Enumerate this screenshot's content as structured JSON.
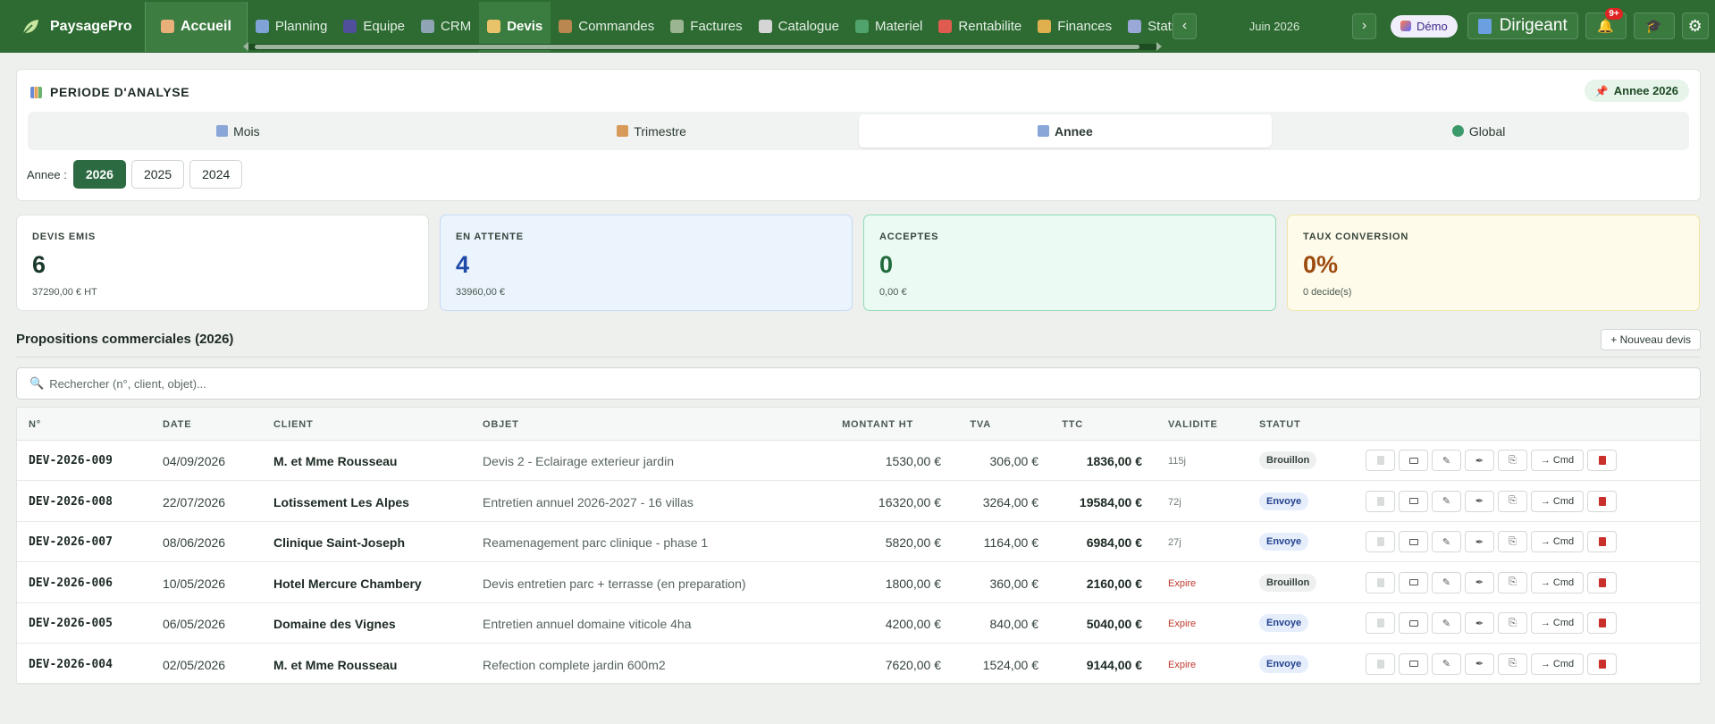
{
  "brand": {
    "name": "PaysagePro",
    "home_label": "Accueil"
  },
  "nav": [
    {
      "label": "Planning",
      "icon": "calendar-icon",
      "color": "#7fa3d6"
    },
    {
      "label": "Equipe",
      "icon": "team-icon",
      "color": "#4f4f9c"
    },
    {
      "label": "CRM",
      "icon": "building-icon",
      "color": "#8fa4b5"
    },
    {
      "label": "Devis",
      "icon": "clipboard-icon",
      "color": "#e9c36a",
      "active": true
    },
    {
      "label": "Commandes",
      "icon": "package-icon",
      "color": "#b9874f"
    },
    {
      "label": "Factures",
      "icon": "ledger-icon",
      "color": "#9ab58f"
    },
    {
      "label": "Catalogue",
      "icon": "tools-icon",
      "color": "#d5d5d5"
    },
    {
      "label": "Materiel",
      "icon": "tractor-icon",
      "color": "#4fa36b"
    },
    {
      "label": "Rentabilite",
      "icon": "target-icon",
      "color": "#e05b4f"
    },
    {
      "label": "Finances",
      "icon": "moneybag-icon",
      "color": "#e0b04f"
    },
    {
      "label": "Stats",
      "icon": "chart-icon",
      "color": "#9aa8d8"
    }
  ],
  "header": {
    "month": "Juin 2026",
    "demo_label": "Démo",
    "role_label": "Dirigeant",
    "notif_count": "9+"
  },
  "period": {
    "title": "PERIODE D'ANALYSE",
    "chip": "Annee 2026",
    "tabs": [
      {
        "label": "Mois",
        "icon": "calendar-icon"
      },
      {
        "label": "Trimestre",
        "icon": "bar-chart-icon"
      },
      {
        "label": "Annee",
        "icon": "calendar-icon",
        "active": true
      },
      {
        "label": "Global",
        "icon": "globe-icon"
      }
    ],
    "year_label": "Annee :",
    "years": [
      "2026",
      "2025",
      "2024"
    ],
    "selected_year": "2026"
  },
  "stats": [
    {
      "label": "DEVIS EMIS",
      "value": "6",
      "sub": "37290,00 € HT"
    },
    {
      "label": "EN ATTENTE",
      "value": "4",
      "sub": "33960,00 €"
    },
    {
      "label": "ACCEPTES",
      "value": "0",
      "sub": "0,00 €"
    },
    {
      "label": "TAUX CONVERSION",
      "value": "0%",
      "sub": "0 decide(s)"
    }
  ],
  "section": {
    "title": "Propositions commerciales (2026)",
    "new_button": "+ Nouveau devis",
    "search_placeholder": "Rechercher (n°, client, objet)..."
  },
  "table": {
    "columns": [
      "N°",
      "DATE",
      "CLIENT",
      "OBJET",
      "MONTANT HT",
      "TVA",
      "TTC",
      "VALIDITE",
      "STATUT"
    ],
    "action_convert": "→ Cmd",
    "rows": [
      {
        "num": "DEV-2026-009",
        "date": "04/09/2026",
        "client": "M. et Mme Rousseau",
        "objet": "Devis 2 - Eclairage exterieur jardin",
        "ht": "1530,00 €",
        "tva": "306,00 €",
        "ttc": "1836,00 €",
        "validite": "115j",
        "expire": false,
        "statut": "Brouillon"
      },
      {
        "num": "DEV-2026-008",
        "date": "22/07/2026",
        "client": "Lotissement Les Alpes",
        "objet": "Entretien annuel 2026-2027 - 16 villas",
        "ht": "16320,00 €",
        "tva": "3264,00 €",
        "ttc": "19584,00 €",
        "validite": "72j",
        "expire": false,
        "statut": "Envoye"
      },
      {
        "num": "DEV-2026-007",
        "date": "08/06/2026",
        "client": "Clinique Saint-Joseph",
        "objet": "Reamenagement parc clinique - phase 1",
        "ht": "5820,00 €",
        "tva": "1164,00 €",
        "ttc": "6984,00 €",
        "validite": "27j",
        "expire": false,
        "statut": "Envoye"
      },
      {
        "num": "DEV-2026-006",
        "date": "10/05/2026",
        "client": "Hotel Mercure Chambery",
        "objet": "Devis entretien parc + terrasse (en preparation)",
        "ht": "1800,00 €",
        "tva": "360,00 €",
        "ttc": "2160,00 €",
        "validite": "Expire",
        "expire": true,
        "statut": "Brouillon"
      },
      {
        "num": "DEV-2026-005",
        "date": "06/05/2026",
        "client": "Domaine des Vignes",
        "objet": "Entretien annuel domaine viticole 4ha",
        "ht": "4200,00 €",
        "tva": "840,00 €",
        "ttc": "5040,00 €",
        "validite": "Expire",
        "expire": true,
        "statut": "Envoye"
      },
      {
        "num": "DEV-2026-004",
        "date": "02/05/2026",
        "client": "M. et Mme Rousseau",
        "objet": "Refection complete jardin 600m2",
        "ht": "7620,00 €",
        "tva": "1524,00 €",
        "ttc": "9144,00 €",
        "validite": "Expire",
        "expire": true,
        "statut": "Envoye"
      }
    ]
  }
}
